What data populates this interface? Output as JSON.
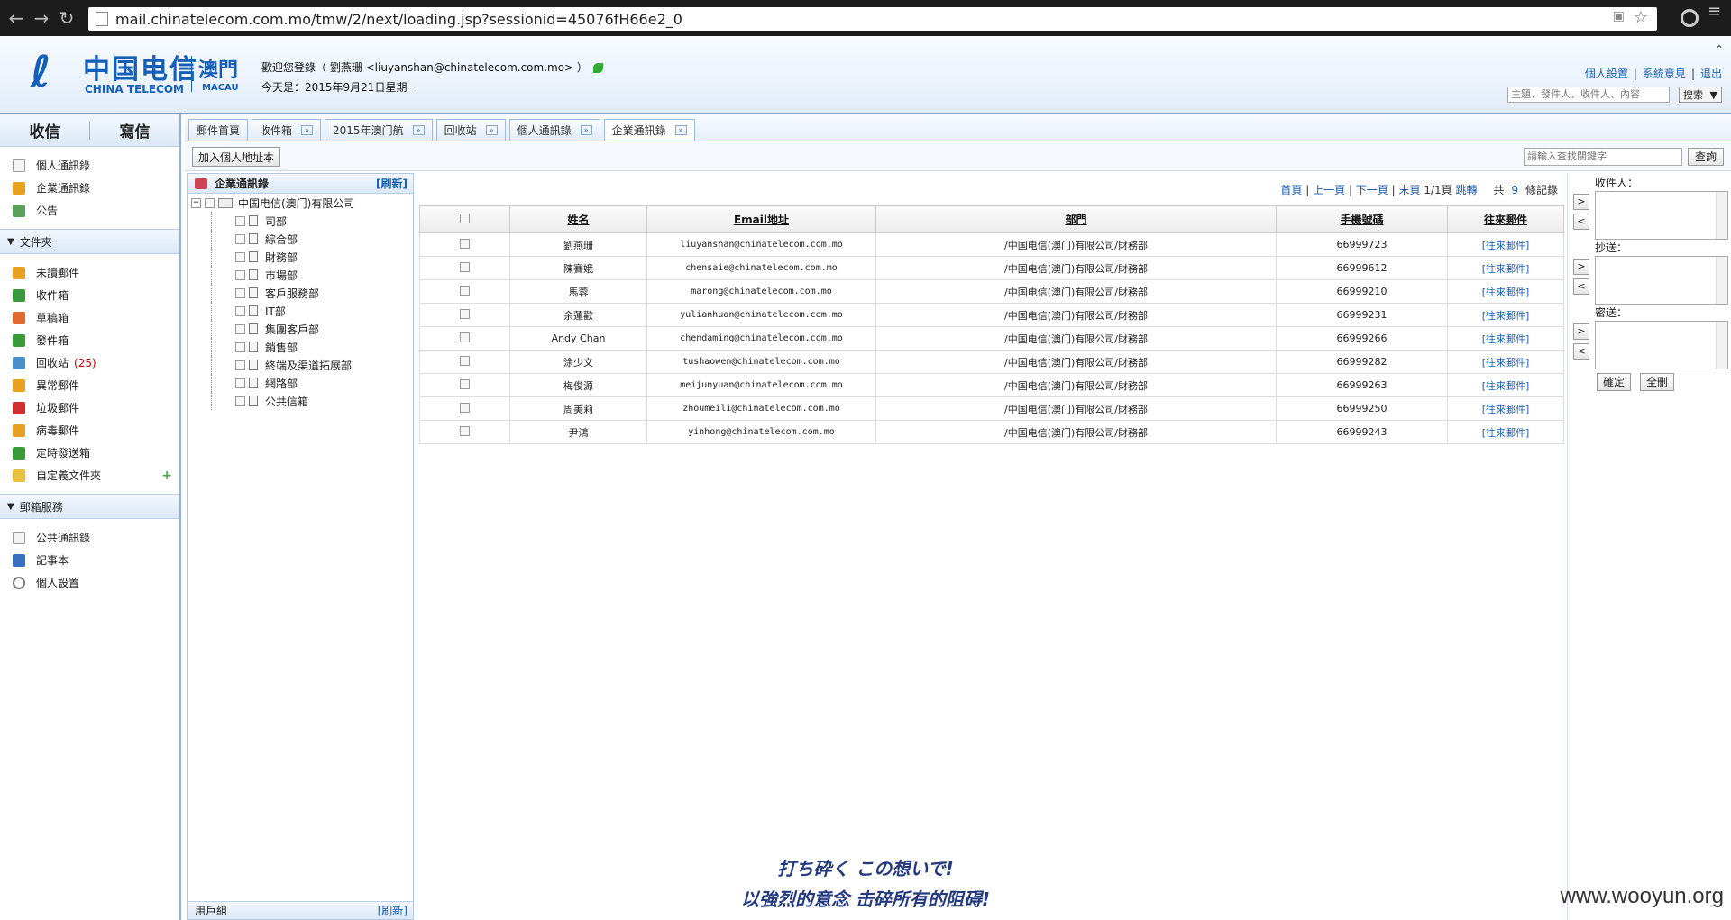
{
  "browser": {
    "url": "mail.chinatelecom.com.mo/tmw/2/next/loading.jsp?sessionid=45076fH66e2_0"
  },
  "header": {
    "logo_cn": "中国电信",
    "logo_en": "CHINA TELECOM",
    "logo_region": "澳門",
    "logo_region_en": "MACAU",
    "welcome": "歡迎您登錄（ 劉燕珊   <liuyanshan@chinatelecom.com.mo> ）",
    "today": "今天是：2015年9月21日星期一",
    "links": [
      "個人設置",
      "系統意見",
      "退出"
    ],
    "search_placeholder": "主題、發件人、收件人、內容",
    "search_button": "搜索"
  },
  "leftnav": {
    "receive": "收信",
    "compose": "寫信",
    "top_items": [
      "個人通訊錄",
      "企業通訊錄",
      "公告"
    ],
    "folders_title": "文件夾",
    "folders": [
      {
        "label": "未讀郵件",
        "color": "#e8a020"
      },
      {
        "label": "收件箱",
        "color": "#3a9a3a"
      },
      {
        "label": "草稿箱",
        "color": "#e06a30"
      },
      {
        "label": "發件箱",
        "color": "#3a9a3a"
      },
      {
        "label": "回收站",
        "color": "#4a90c8",
        "count": "(25)"
      },
      {
        "label": "異常郵件",
        "color": "#e8a020"
      },
      {
        "label": "垃圾郵件",
        "color": "#d03030"
      },
      {
        "label": "病毒郵件",
        "color": "#e8a020"
      },
      {
        "label": "定時發送箱",
        "color": "#3a9a3a"
      },
      {
        "label": "自定義文件夾",
        "color": "#e8c040"
      }
    ],
    "services_title": "郵箱服務",
    "services": [
      "公共通訊錄",
      "記事本",
      "個人設置"
    ]
  },
  "tabs": [
    {
      "label": "郵件首頁",
      "closable": false
    },
    {
      "label": "收件箱",
      "closable": true
    },
    {
      "label": "2015年澳门航",
      "closable": true
    },
    {
      "label": "回收站",
      "closable": true
    },
    {
      "label": "個人通訊錄",
      "closable": true
    },
    {
      "label": "企業通訊錄",
      "closable": true,
      "active": true
    }
  ],
  "toolbar": {
    "add_button": "加入個人地址本",
    "keyword_placeholder": "請輸入查找關鍵字",
    "query_button": "查詢"
  },
  "tree": {
    "title": "企業通訊錄",
    "refresh": "[刷新]",
    "root": "中国电信(澳门)有限公司",
    "children": [
      "司部",
      "綜合部",
      "財務部",
      "市場部",
      "客戶服務部",
      "IT部",
      "集團客戶部",
      "銷售部",
      "終端及渠道拓展部",
      "網路部",
      "公共信箱"
    ],
    "footer": "用戶組",
    "footer_refresh": "[刷新]"
  },
  "pager": {
    "first": "首頁",
    "prev": "上一頁",
    "next": "下一頁",
    "last": "末頁",
    "page": "1/1頁",
    "jump": "跳轉",
    "total_prefix": "共",
    "total": "9",
    "total_suffix": "條記錄"
  },
  "table": {
    "headers": [
      "姓名",
      "Email地址",
      "部門",
      "手機號碼",
      "往來郵件"
    ],
    "rows": [
      {
        "name": "劉燕珊",
        "email": "liuyanshan@chinatelecom.com.mo",
        "dept": "/中国电信(澳门)有限公司/財務部",
        "phone": "66999723",
        "action": "[往來郵件]"
      },
      {
        "name": "陳賽娥",
        "email": "chensaie@chinatelecom.com.mo",
        "dept": "/中国电信(澳门)有限公司/財務部",
        "phone": "66999612",
        "action": "[往來郵件]"
      },
      {
        "name": "馬蓉",
        "email": "marong@chinatelecom.com.mo",
        "dept": "/中国电信(澳门)有限公司/財務部",
        "phone": "66999210",
        "action": "[往來郵件]"
      },
      {
        "name": "余蓮歡",
        "email": "yulianhuan@chinatelecom.com.mo",
        "dept": "/中国电信(澳门)有限公司/財務部",
        "phone": "66999231",
        "action": "[往來郵件]"
      },
      {
        "name": "Andy Chan",
        "email": "chendaming@chinatelecom.com.mo",
        "dept": "/中国电信(澳门)有限公司/財務部",
        "phone": "66999266",
        "action": "[往來郵件]"
      },
      {
        "name": "涂少文",
        "email": "tushaowen@chinatelecom.com.mo",
        "dept": "/中国电信(澳门)有限公司/財務部",
        "phone": "66999282",
        "action": "[往來郵件]"
      },
      {
        "name": "梅俊源",
        "email": "meijunyuan@chinatelecom.com.mo",
        "dept": "/中国电信(澳门)有限公司/財務部",
        "phone": "66999263",
        "action": "[往來郵件]"
      },
      {
        "name": "周美莉",
        "email": "zhoumeili@chinatelecom.com.mo",
        "dept": "/中国电信(澳门)有限公司/財務部",
        "phone": "66999250",
        "action": "[往來郵件]"
      },
      {
        "name": "尹鴻",
        "email": "yinhong@chinatelecom.com.mo",
        "dept": "/中国电信(澳门)有限公司/財務部",
        "phone": "66999243",
        "action": "[往來郵件]"
      }
    ]
  },
  "recipients": {
    "to_label": "收件人：",
    "cc_label": "抄送：",
    "bcc_label": "密送：",
    "confirm": "確定",
    "delete_all": "全刪"
  },
  "overlay": {
    "subtitle_jp": "打ち砕く この想いで!",
    "subtitle_cn": "以強烈的意念 击碎所有的阻碍!",
    "watermark": "www.wooyun.org"
  }
}
